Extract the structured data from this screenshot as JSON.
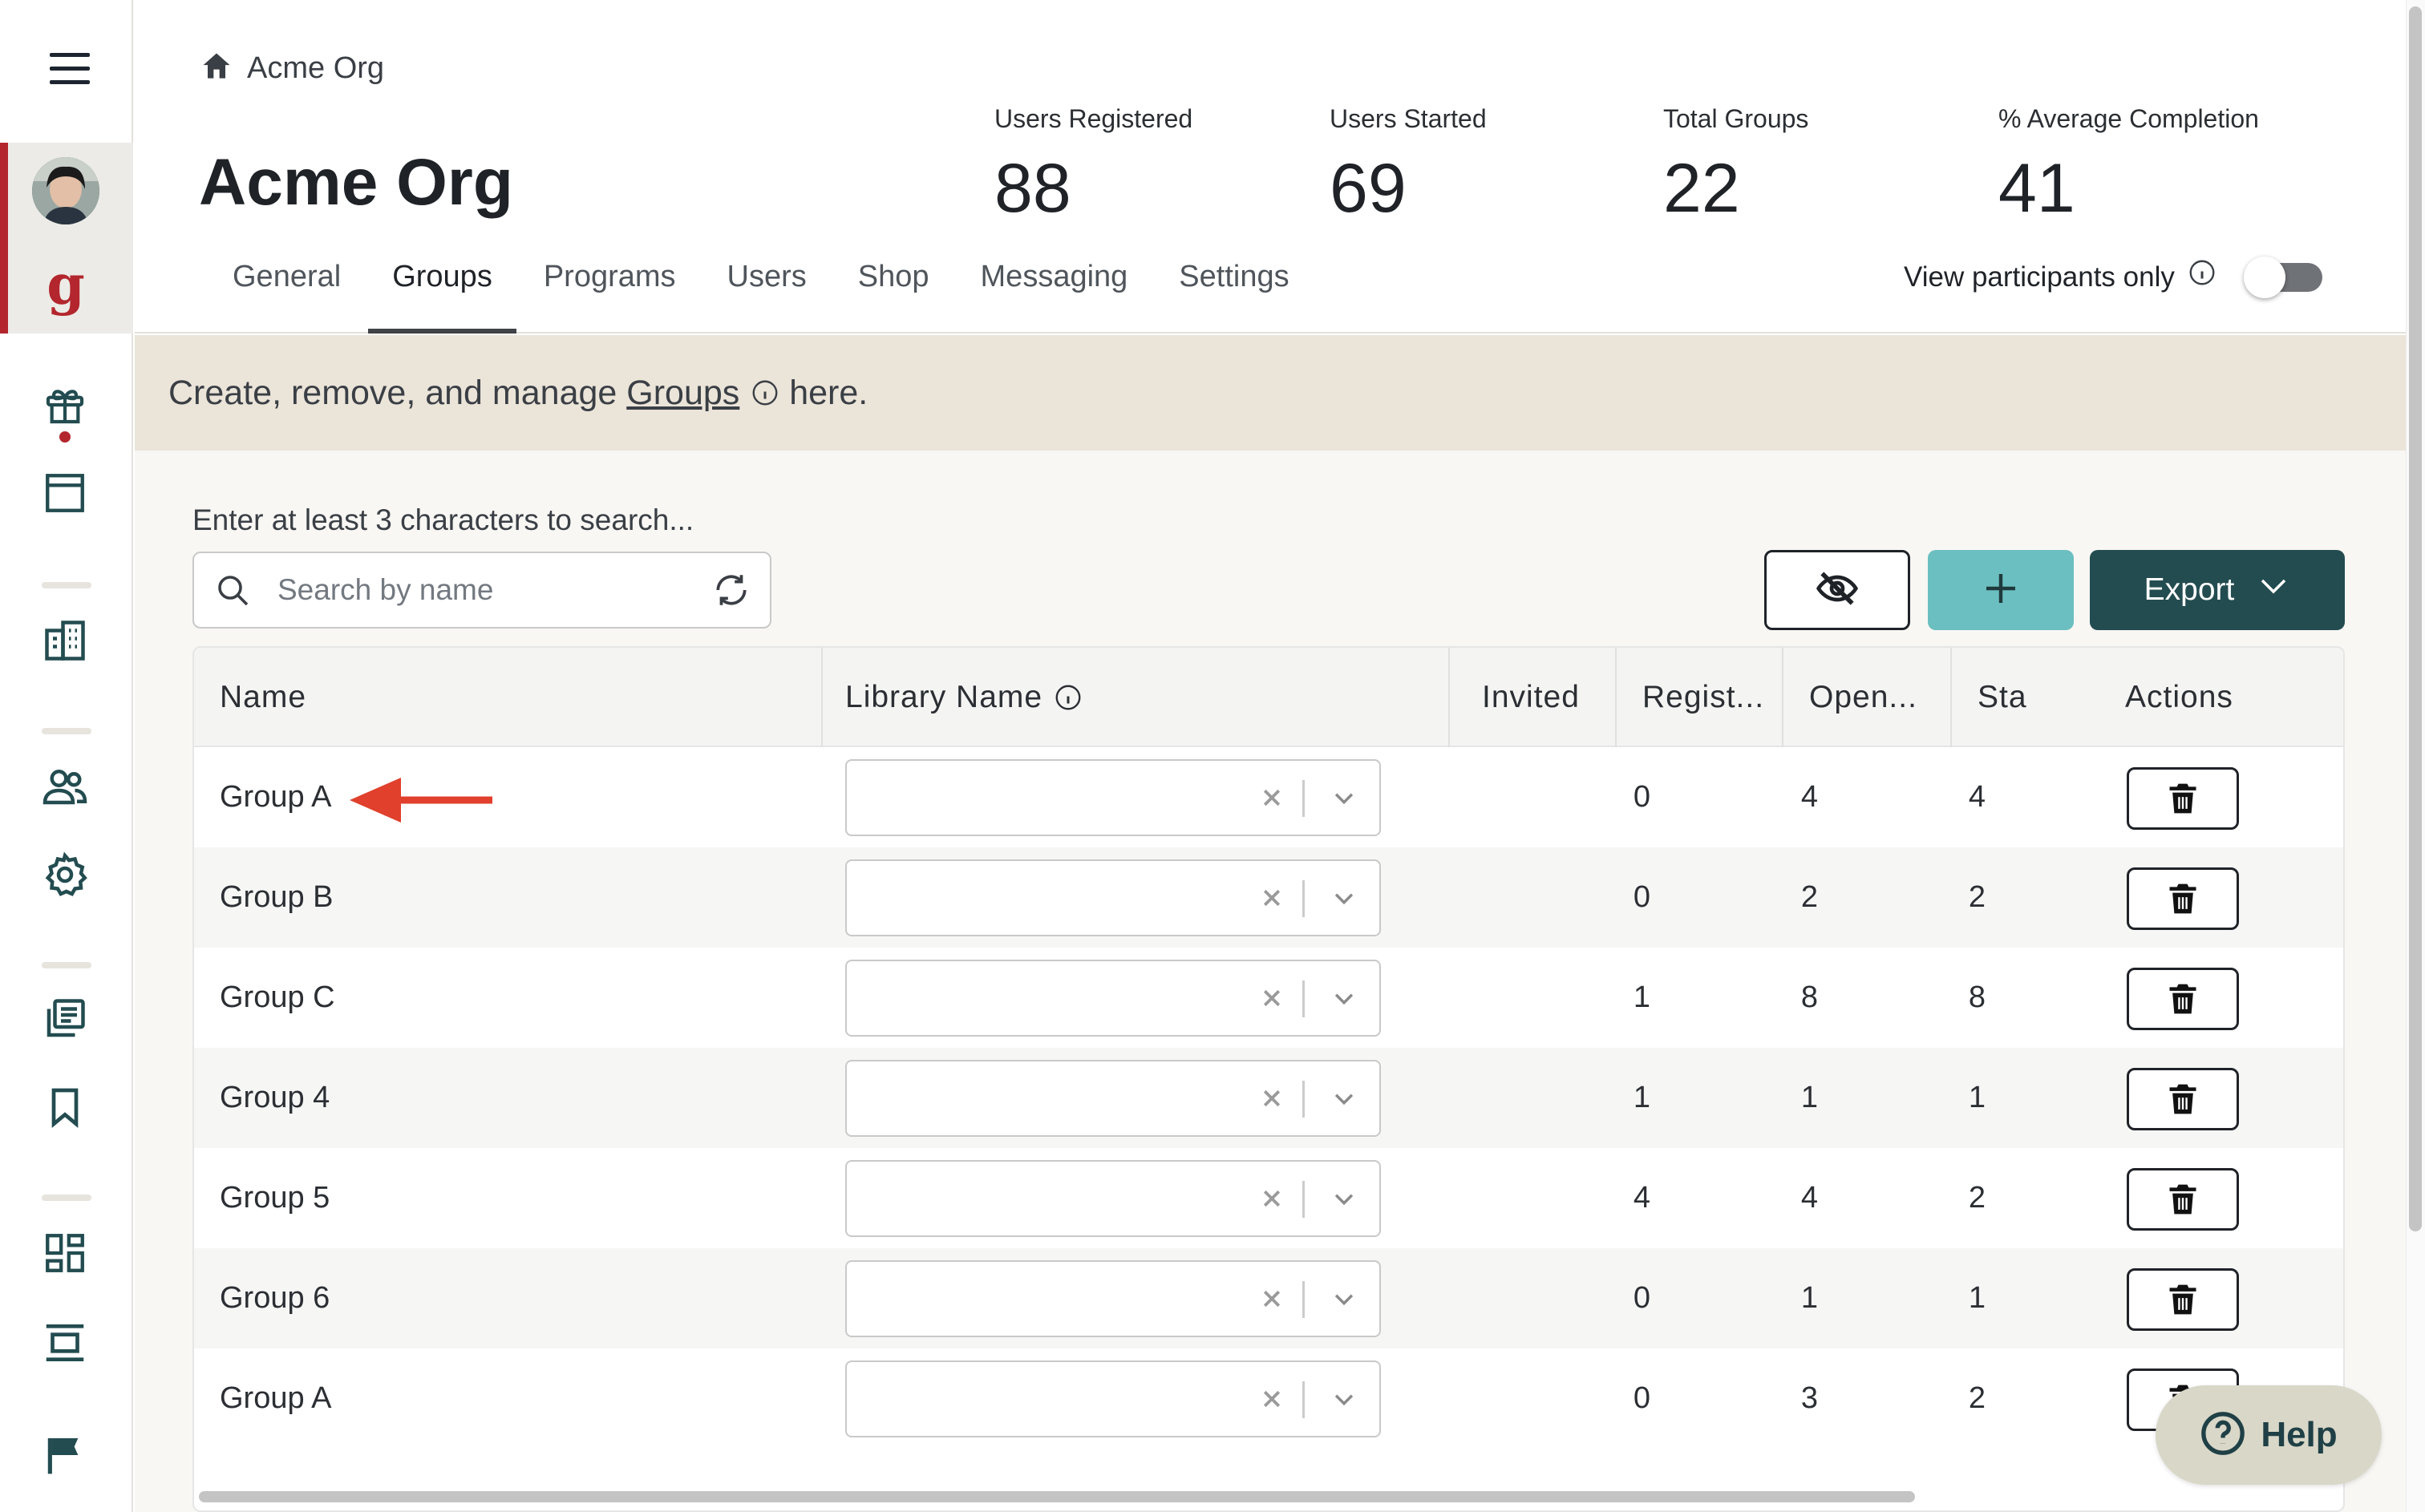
{
  "breadcrumb": {
    "label": "Acme Org"
  },
  "page": {
    "title": "Acme Org"
  },
  "stats": [
    {
      "label": "Users Registered",
      "value": "88"
    },
    {
      "label": "Users Started",
      "value": "69"
    },
    {
      "label": "Total Groups",
      "value": "22"
    },
    {
      "label": "% Average Completion",
      "value": "41"
    }
  ],
  "tabs": [
    "General",
    "Groups",
    "Programs",
    "Users",
    "Shop",
    "Messaging",
    "Settings"
  ],
  "active_tab": "Groups",
  "participants_toggle": {
    "label": "View participants only",
    "on": false
  },
  "banner": {
    "before": "Create, remove, and manage ",
    "link": "Groups",
    "after": " here."
  },
  "search": {
    "hint": "Enter at least 3 characters to search...",
    "placeholder": "Search by name",
    "value": ""
  },
  "toolbar": {
    "export_label": "Export"
  },
  "table": {
    "columns": {
      "name": "Name",
      "library": "Library Name",
      "invited": "Invited",
      "registered": "Regist...",
      "opened": "Open...",
      "started": "Sta",
      "actions": "Actions"
    },
    "rows": [
      {
        "name": "Group A",
        "library": "",
        "invited": "0",
        "registered": "4",
        "opened": "4"
      },
      {
        "name": "Group B",
        "library": "",
        "invited": "0",
        "registered": "2",
        "opened": "2"
      },
      {
        "name": "Group C",
        "library": "",
        "invited": "1",
        "registered": "8",
        "opened": "8"
      },
      {
        "name": "Group 4",
        "library": "",
        "invited": "1",
        "registered": "1",
        "opened": "1"
      },
      {
        "name": "Group 5",
        "library": "",
        "invited": "4",
        "registered": "4",
        "opened": "2"
      },
      {
        "name": "Group 6",
        "library": "",
        "invited": "0",
        "registered": "1",
        "opened": "1"
      },
      {
        "name": "Group A",
        "library": "",
        "invited": "0",
        "registered": "3",
        "opened": "2"
      }
    ]
  },
  "help": {
    "label": "Help"
  },
  "colors": {
    "brand_red": "#b3262d",
    "teal_dark": "#234c50",
    "teal_light": "#6bbfc0",
    "banner_bg": "#ebe4d9",
    "arrow": "#e0402c"
  }
}
